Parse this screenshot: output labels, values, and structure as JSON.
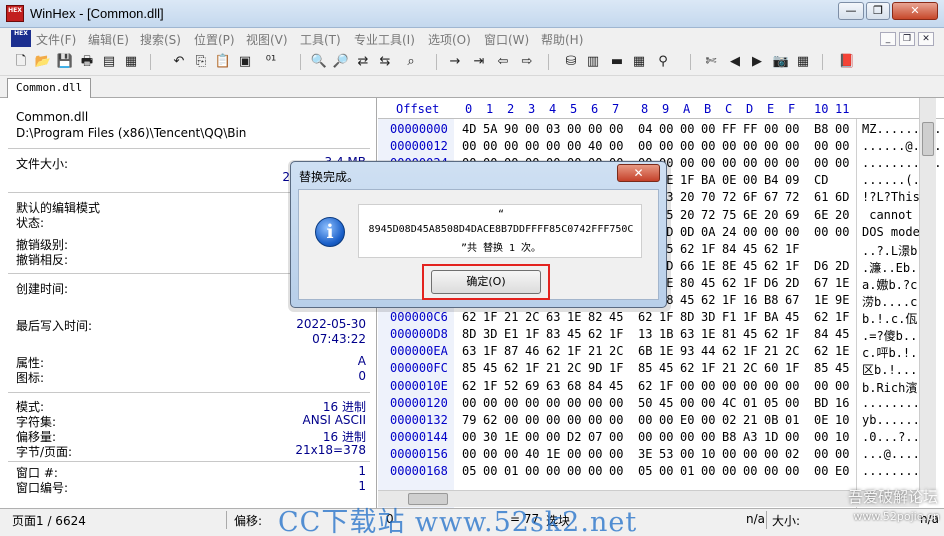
{
  "window": {
    "title": "WinHex - [Common.dll]",
    "icon_label": "HEX",
    "controls": {
      "minimize": "—",
      "restore": "❐",
      "close": "✕"
    }
  },
  "menubar": {
    "logo": "HEX",
    "items": [
      "文件(F)",
      "编辑(E)",
      "搜索(S)",
      "位置(P)",
      "视图(V)",
      "工具(T)",
      "专业工具(I)",
      "选项(O)",
      "窗口(W)",
      "帮助(H)"
    ],
    "mdi": [
      "_",
      "❐",
      "✕"
    ]
  },
  "toolbar": {
    "icons": [
      {
        "name": "new-file-icon",
        "glyph": "🗋"
      },
      {
        "name": "open-folder-icon",
        "glyph": "📂"
      },
      {
        "name": "save-icon",
        "glyph": "💾"
      },
      {
        "name": "print-icon",
        "glyph": "🖶"
      },
      {
        "name": "properties-icon",
        "glyph": "▤"
      },
      {
        "name": "open-disk-icon",
        "glyph": "▦"
      },
      {
        "name": "undo-icon",
        "glyph": "↶"
      },
      {
        "name": "copy-icon",
        "glyph": "⎘"
      },
      {
        "name": "paste-icon",
        "glyph": "📋"
      },
      {
        "name": "clipboard-icon",
        "glyph": "▣"
      },
      {
        "name": "binary-icon",
        "glyph": "⁰¹"
      },
      {
        "name": "find-text-icon",
        "glyph": "🔍"
      },
      {
        "name": "find-hex-icon",
        "glyph": "🔎"
      },
      {
        "name": "replace-text-icon",
        "glyph": "⇄"
      },
      {
        "name": "replace-hex-icon",
        "glyph": "⇆"
      },
      {
        "name": "find-again-icon",
        "glyph": "⌕"
      },
      {
        "name": "goto-offset-icon",
        "glyph": "→"
      },
      {
        "name": "jump-icon",
        "glyph": "⇥"
      },
      {
        "name": "back-icon",
        "glyph": "⇦"
      },
      {
        "name": "forward-icon",
        "glyph": "⇨"
      },
      {
        "name": "disk-icon",
        "glyph": "⛁"
      },
      {
        "name": "window-icon",
        "glyph": "▥"
      },
      {
        "name": "ram-icon",
        "glyph": "▬"
      },
      {
        "name": "calculator-icon",
        "glyph": "▦"
      },
      {
        "name": "zoom-icon",
        "glyph": "⚲"
      },
      {
        "name": "cut-icon",
        "glyph": "✄"
      },
      {
        "name": "prev-icon",
        "glyph": "◀"
      },
      {
        "name": "next-icon",
        "glyph": "▶"
      },
      {
        "name": "camera-icon",
        "glyph": "📷"
      },
      {
        "name": "grid-icon",
        "glyph": "▦"
      },
      {
        "name": "book-icon",
        "glyph": "📕"
      }
    ]
  },
  "tabs": [
    {
      "label": "Common.dll"
    }
  ],
  "info": {
    "filename": "Common.dll",
    "path": "D:\\Program Files (x86)\\Tencent\\QQ\\Bin",
    "file_size_label": "文件大小:",
    "file_size_value": "3.4 MB",
    "file_size_value2": "2",
    "edit_mode_label": "默认的编辑模式",
    "state_label": "状态:",
    "undo_level_label": "撤销级别:",
    "undo_reverse_label": "撤销相反:",
    "created_label": "创建时间:",
    "modified_label": "最后写入时间:",
    "modified_date": "2022-05-30",
    "modified_time": "07:43:22",
    "attr_label": "属性:",
    "attr_value": "A",
    "icons_label": "图标:",
    "icons_value": "0",
    "mode_label": "模式:",
    "mode_value": "16 进制",
    "charset_label": "字符集:",
    "charset_value": "ANSI ASCII",
    "offset_label": "偏移量:",
    "offset_value": "16 进制",
    "bpp_label": "字节/页面:",
    "bpp_value": "21x18=378",
    "window_num_label": "窗口 #:",
    "window_num_value": "1",
    "window_id_label": "窗口编号:",
    "window_id_value": "1"
  },
  "hex": {
    "header_offset": "Offset",
    "columns": [
      "0",
      "1",
      "2",
      "3",
      "4",
      "5",
      "6",
      "7",
      "8",
      "9",
      "A",
      "B",
      "C",
      "D",
      "E",
      "F",
      "10",
      "11"
    ],
    "rows": [
      {
        "offset": "00000000",
        "bytes": [
          "4D",
          "5A",
          "90",
          "00",
          "03",
          "00",
          "00",
          "00",
          "04",
          "00",
          "00",
          "00",
          "FF",
          "FF",
          "00",
          "00",
          "B8",
          "00"
        ],
        "text": "MZ........."
      },
      {
        "offset": "00000012",
        "bytes": [
          "00",
          "00",
          "00",
          "00",
          "00",
          "00",
          "40",
          "00",
          "00",
          "00",
          "00",
          "00",
          "00",
          "00",
          "00",
          "00",
          "00",
          "00"
        ],
        "text": "......@...."
      },
      {
        "offset": "00000024",
        "bytes": [
          "00",
          "00",
          "00",
          "00",
          "00",
          "00",
          "00",
          "00",
          "00",
          "00",
          "00",
          "00",
          "00",
          "00",
          "00",
          "00",
          "00",
          "00"
        ],
        "text": "..........."
      },
      {
        "offset": "00000036",
        "bytes": [
          "00",
          "00",
          "00",
          "00",
          "00",
          "00",
          "00",
          "00",
          "00",
          "0E",
          "1F",
          "BA",
          "0E",
          "00",
          "B4",
          "09",
          "CD"
        ],
        "text": "......(."
      },
      {
        "offset": "00000048",
        "bytes": [
          "21",
          "B8",
          "01",
          "4C",
          "CD",
          "21",
          "54",
          "68",
          "69",
          "73",
          "20",
          "70",
          "72",
          "6F",
          "67",
          "72",
          "61",
          "6D"
        ],
        "text": "!?L?This"
      },
      {
        "offset": "0000005A",
        "bytes": [
          "20",
          "63",
          "61",
          "6E",
          "6E",
          "6F",
          "74",
          "20",
          "62",
          "65",
          "20",
          "72",
          "75",
          "6E",
          "20",
          "69",
          "6E",
          "20"
        ],
        "text": " cannot"
      },
      {
        "offset": "0000006C",
        "bytes": [
          "44",
          "4F",
          "53",
          "20",
          "6D",
          "6F",
          "64",
          "65",
          "2E",
          "0D",
          "0D",
          "0A",
          "24",
          "00",
          "00",
          "00",
          "00",
          "00"
        ],
        "text": "DOS mode"
      },
      {
        "offset": "0000007E",
        "bytes": [
          "00",
          "00",
          "8B",
          "04",
          "2E",
          "00",
          "62",
          "1F",
          "84",
          "45",
          "62",
          "1F",
          "84",
          "45",
          "62",
          "1F"
        ],
        "text": "..?.L澋b"
      },
      {
        "offset": "00000090",
        "bytes": [
          "84",
          "45",
          "62",
          "1F",
          "84",
          "45",
          "62",
          "1F",
          "D6",
          "2D",
          "66",
          "1E",
          "8E",
          "45",
          "62",
          "1F",
          "D6",
          "2D"
        ],
        "text": ".濂..Eb."
      },
      {
        "offset": "000000A2",
        "bytes": [
          "66",
          "1E",
          "80",
          "45",
          "62",
          "1F",
          "D6",
          "2D",
          "66",
          "1E",
          "80",
          "45",
          "62",
          "1F",
          "D6",
          "2D",
          "67",
          "1E"
        ],
        "text": "a.嫐b.?c"
      },
      {
        "offset": "000000B4",
        "bytes": [
          "9E",
          "45",
          "62",
          "1F",
          "D6",
          "2D",
          "67",
          "1E",
          "16",
          "B8",
          "45",
          "62",
          "1F",
          "16",
          "B8",
          "67",
          "1E",
          "9E",
          "45"
        ],
        "text": "涝b....c."
      },
      {
        "offset": "000000C6",
        "bytes": [
          "62",
          "1F",
          "21",
          "2C",
          "63",
          "1E",
          "82",
          "45",
          "62",
          "1F",
          "8D",
          "3D",
          "F1",
          "1F",
          "BA",
          "45",
          "62",
          "1F"
        ],
        "text": "b.!.c.佤"
      },
      {
        "offset": "000000D8",
        "bytes": [
          "8D",
          "3D",
          "E1",
          "1F",
          "83",
          "45",
          "62",
          "1F",
          "13",
          "1B",
          "63",
          "1E",
          "81",
          "45",
          "62",
          "1F",
          "84",
          "45"
        ],
        "text": ".=?傻b.."
      },
      {
        "offset": "000000EA",
        "bytes": [
          "63",
          "1F",
          "87",
          "46",
          "62",
          "1F",
          "21",
          "2C",
          "6B",
          "1E",
          "93",
          "44",
          "62",
          "1F",
          "21",
          "2C",
          "62",
          "1E"
        ],
        "text": "c.呯b.!."
      },
      {
        "offset": "000000FC",
        "bytes": [
          "85",
          "45",
          "62",
          "1F",
          "21",
          "2C",
          "9D",
          "1F",
          "85",
          "45",
          "62",
          "1F",
          "21",
          "2C",
          "60",
          "1F",
          "85",
          "45"
        ],
        "text": "区b.!...."
      },
      {
        "offset": "0000010E",
        "bytes": [
          "62",
          "1F",
          "52",
          "69",
          "63",
          "68",
          "84",
          "45",
          "62",
          "1F",
          "00",
          "00",
          "00",
          "00",
          "00",
          "00",
          "00",
          "00"
        ],
        "text": "b.Rich濱"
      },
      {
        "offset": "00000120",
        "bytes": [
          "00",
          "00",
          "00",
          "00",
          "00",
          "00",
          "00",
          "00",
          "50",
          "45",
          "00",
          "00",
          "4C",
          "01",
          "05",
          "00",
          "BD",
          "16"
        ],
        "text": "........."
      },
      {
        "offset": "00000132",
        "bytes": [
          "79",
          "62",
          "00",
          "00",
          "00",
          "00",
          "00",
          "00",
          "00",
          "00",
          "E0",
          "00",
          "02",
          "21",
          "0B",
          "01",
          "0E",
          "10"
        ],
        "text": "yb......."
      },
      {
        "offset": "00000144",
        "bytes": [
          "00",
          "30",
          "1E",
          "00",
          "00",
          "D2",
          "07",
          "00",
          "00",
          "00",
          "00",
          "00",
          "B8",
          "A3",
          "1D",
          "00",
          "00",
          "10"
        ],
        "text": ".0...?..."
      },
      {
        "offset": "00000156",
        "bytes": [
          "00",
          "00",
          "00",
          "40",
          "1E",
          "00",
          "00",
          "00",
          "3E",
          "53",
          "00",
          "10",
          "00",
          "00",
          "00",
          "02",
          "00",
          "00"
        ],
        "text": "...@....."
      },
      {
        "offset": "00000168",
        "bytes": [
          "05",
          "00",
          "01",
          "00",
          "00",
          "00",
          "00",
          "00",
          "05",
          "00",
          "01",
          "00",
          "00",
          "00",
          "00",
          "00",
          "00",
          "E0"
        ],
        "text": "........."
      }
    ]
  },
  "status": {
    "page": "页面1 / 6624",
    "offset_label": "偏移:",
    "offset_value": "0",
    "equals": "= 77",
    "selection_label": "选块",
    "na1": "n/a",
    "size_label": "大小:",
    "na2": "n/a"
  },
  "watermarks": {
    "main": "CC下载站 www.52sk2.net",
    "corner1": "吾爱破解论坛",
    "corner2": "www.52pojie.cn"
  },
  "dialog": {
    "title": "替换完成。",
    "close": "✕",
    "info_icon": "i",
    "msg_quote": "“",
    "msg_hex": "8945D08D45A8508D4DACE8B7DDFFFF85C0742FFF750C",
    "msg_result": "”共 替换 1 次。",
    "ok_label": "确定(O)"
  }
}
